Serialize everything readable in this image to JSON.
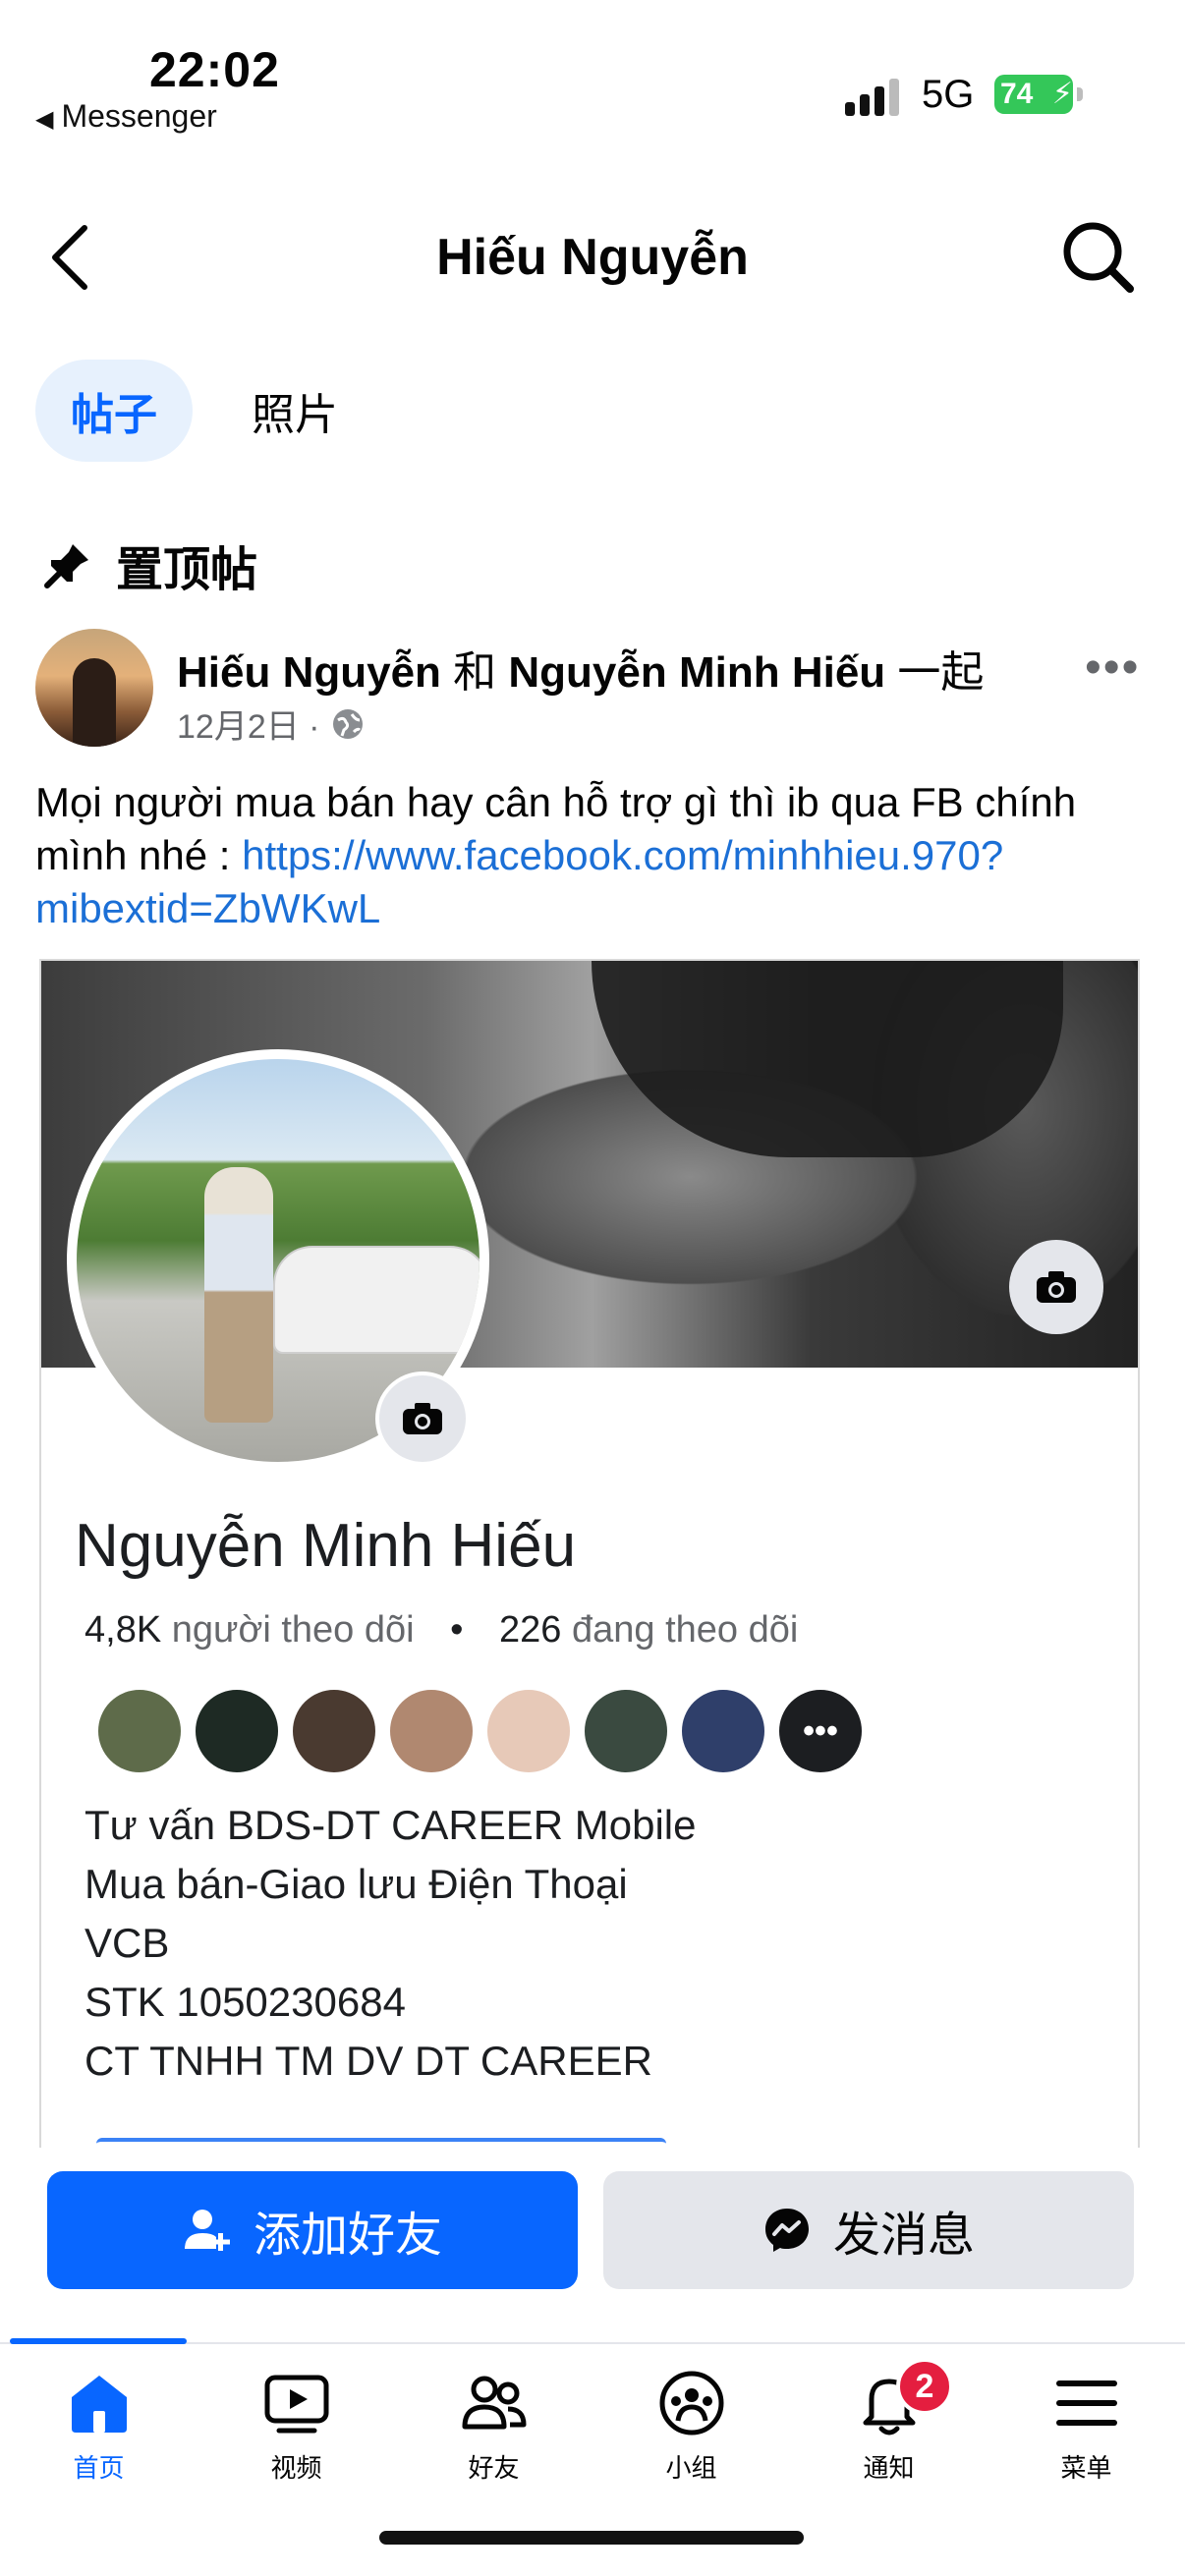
{
  "status_bar": {
    "time": "22:02",
    "back_app": "Messenger",
    "network": "5G",
    "battery": "74"
  },
  "header": {
    "title": "Hiếu Nguyễn"
  },
  "tabs": [
    {
      "label": "帖子",
      "active": true
    },
    {
      "label": "照片",
      "active": false
    }
  ],
  "pinned": {
    "heading": "置顶帖"
  },
  "post": {
    "author": "Hiếu Nguyễn",
    "connector": "和",
    "with": "Nguyễn Minh Hiếu",
    "suffix": "一起",
    "date": "12月2日 ·",
    "text": "Mọi người mua bán hay cân hỗ trợ gì thì ib qua FB chính mình nhé : ",
    "link": "https://www.facebook.com/minhhieu.970?mibextid=ZbWKwL",
    "embed": {
      "name": "Nguyễn Minh Hiếu",
      "followers_count": "4,8K",
      "followers_label": "người theo dõi",
      "following_count": "226",
      "following_label": "đang theo dõi",
      "bio": [
        "Tư vấn BDS-DT CAREER Mobile",
        "Mua bán-Giao lưu Điện Thoại",
        "VCB",
        "STK 1050230684",
        "CT TNHH TM DV DT CAREER"
      ]
    }
  },
  "actions": {
    "add_friend": "添加好友",
    "message": "发消息"
  },
  "nav": [
    {
      "label": "首页",
      "icon": "home-icon",
      "active": true
    },
    {
      "label": "视频",
      "icon": "video-icon",
      "active": false
    },
    {
      "label": "好友",
      "icon": "friends-icon",
      "active": false
    },
    {
      "label": "小组",
      "icon": "groups-icon",
      "active": false
    },
    {
      "label": "通知",
      "icon": "bell-icon",
      "active": false,
      "badge": "2"
    },
    {
      "label": "菜单",
      "icon": "menu-icon",
      "active": false
    }
  ],
  "colors": {
    "accent": "#0866ff",
    "badge": "#e41e3f",
    "link": "#1b6fd6",
    "battery": "#34c759"
  }
}
